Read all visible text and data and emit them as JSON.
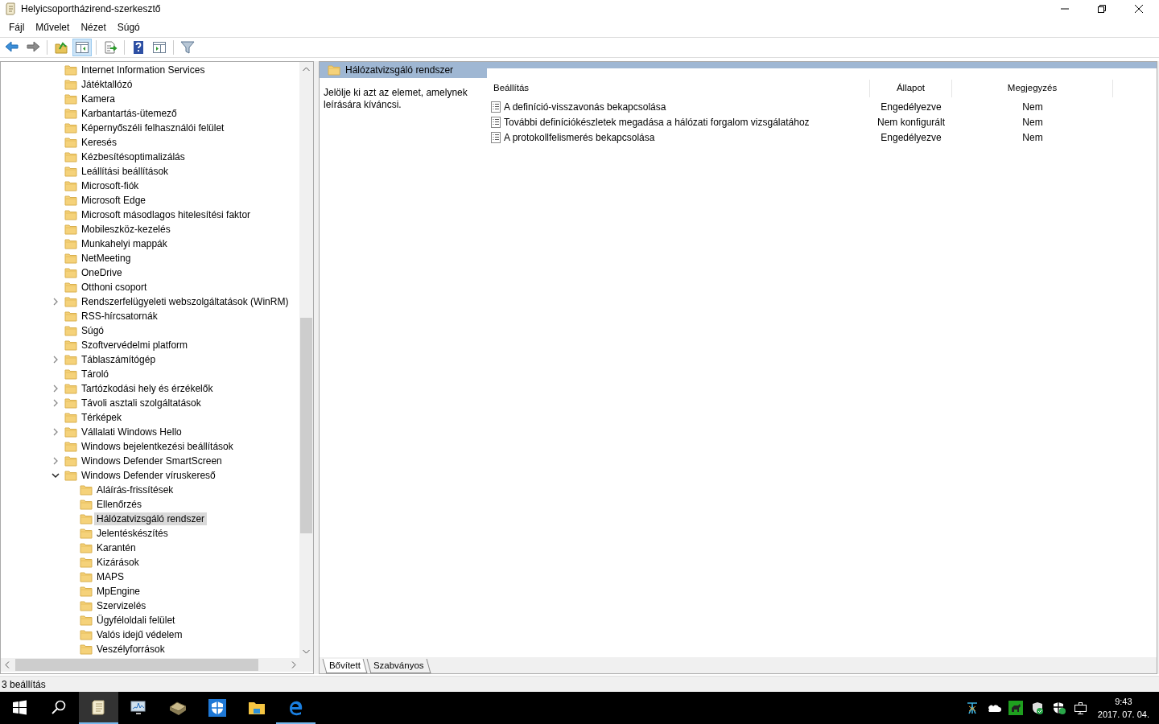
{
  "window": {
    "title": "Helyicsoportházirend-szerkesztő"
  },
  "menu": [
    "Fájl",
    "Művelet",
    "Nézet",
    "Súgó"
  ],
  "toolbar": [
    [
      {
        "kind": "back",
        "pressed": false
      },
      {
        "kind": "forward",
        "pressed": false
      }
    ],
    [
      {
        "kind": "up",
        "pressed": false
      },
      {
        "kind": "tree",
        "pressed": true
      }
    ],
    [
      {
        "kind": "export",
        "pressed": false
      }
    ],
    [
      {
        "kind": "help",
        "pressed": false
      },
      {
        "kind": "panel",
        "pressed": false
      }
    ],
    [
      {
        "kind": "filter",
        "pressed": false
      }
    ]
  ],
  "tree": [
    {
      "label": "Internet Information Services",
      "kind": "leaf",
      "selected": false
    },
    {
      "label": "Játéktallózó",
      "kind": "leaf",
      "selected": false
    },
    {
      "label": "Kamera",
      "kind": "leaf",
      "selected": false
    },
    {
      "label": "Karbantartás-ütemező",
      "kind": "leaf",
      "selected": false
    },
    {
      "label": "Képernyőszéli felhasználói felület",
      "kind": "leaf",
      "selected": false
    },
    {
      "label": "Keresés",
      "kind": "leaf",
      "selected": false
    },
    {
      "label": "Kézbesítésoptimalizálás",
      "kind": "leaf",
      "selected": false
    },
    {
      "label": "Leállítási beállítások",
      "kind": "leaf",
      "selected": false
    },
    {
      "label": "Microsoft-fiók",
      "kind": "leaf",
      "selected": false
    },
    {
      "label": "Microsoft Edge",
      "kind": "leaf",
      "selected": false
    },
    {
      "label": "Microsoft másodlagos hitelesítési faktor",
      "kind": "leaf",
      "selected": false
    },
    {
      "label": "Mobileszköz-kezelés",
      "kind": "leaf",
      "selected": false
    },
    {
      "label": "Munkahelyi mappák",
      "kind": "leaf",
      "selected": false
    },
    {
      "label": "NetMeeting",
      "kind": "leaf",
      "selected": false
    },
    {
      "label": "OneDrive",
      "kind": "leaf",
      "selected": false
    },
    {
      "label": "Otthoni csoport",
      "kind": "leaf",
      "selected": false
    },
    {
      "label": "Rendszerfelügyeleti webszolgáltatások (WinRM)",
      "kind": "group",
      "expanded": false,
      "selected": false
    },
    {
      "label": "RSS-hírcsatornák",
      "kind": "leaf",
      "selected": false
    },
    {
      "label": "Súgó",
      "kind": "leaf",
      "selected": false
    },
    {
      "label": "Szoftvervédelmi platform",
      "kind": "leaf",
      "selected": false
    },
    {
      "label": "Táblaszámítógép",
      "kind": "group",
      "expanded": false,
      "selected": false
    },
    {
      "label": "Tároló",
      "kind": "leaf",
      "selected": false
    },
    {
      "label": "Tartózkodási hely és érzékelők",
      "kind": "group",
      "expanded": false,
      "selected": false
    },
    {
      "label": "Távoli asztali szolgáltatások",
      "kind": "group",
      "expanded": false,
      "selected": false
    },
    {
      "label": "Térképek",
      "kind": "leaf",
      "selected": false
    },
    {
      "label": "Vállalati Windows Hello",
      "kind": "group",
      "expanded": false,
      "selected": false
    },
    {
      "label": "Windows bejelentkezési beállítások",
      "kind": "leaf",
      "selected": false
    },
    {
      "label": "Windows Defender SmartScreen",
      "kind": "group",
      "expanded": false,
      "selected": false
    },
    {
      "label": "Windows Defender víruskereső",
      "kind": "group",
      "expanded": true,
      "selected": false,
      "children": [
        {
          "label": "Aláírás-frissítések",
          "kind": "leaf",
          "selected": false
        },
        {
          "label": "Ellenőrzés",
          "kind": "leaf",
          "selected": false
        },
        {
          "label": "Hálózatvizsgáló rendszer",
          "kind": "leaf",
          "selected": true
        },
        {
          "label": "Jelentéskészítés",
          "kind": "leaf",
          "selected": false
        },
        {
          "label": "Karantén",
          "kind": "leaf",
          "selected": false
        },
        {
          "label": "Kizárások",
          "kind": "leaf",
          "selected": false
        },
        {
          "label": "MAPS",
          "kind": "leaf",
          "selected": false
        },
        {
          "label": "MpEngine",
          "kind": "leaf",
          "selected": false
        },
        {
          "label": "Szervizelés",
          "kind": "leaf",
          "selected": false
        },
        {
          "label": "Ügyféloldali felület",
          "kind": "leaf",
          "selected": false
        },
        {
          "label": "Valós idejű védelem",
          "kind": "leaf",
          "selected": false
        },
        {
          "label": "Veszélyforrások",
          "kind": "leaf",
          "selected": false
        }
      ]
    }
  ],
  "details": {
    "header": "Hálózatvizsgáló rendszer",
    "description": "Jelölje ki azt az elemet, amelynek leírására kíváncsi.",
    "columns": [
      "Beállítás",
      "Állapot",
      "Megjegyzés"
    ],
    "rows": [
      {
        "setting": "A definíció-visszavonás bekapcsolása",
        "state": "Engedélyezve",
        "comment": "Nem"
      },
      {
        "setting": "További definíciókészletek megadása a hálózati forgalom vizsgálatához",
        "state": "Nem konfigurált",
        "comment": "Nem"
      },
      {
        "setting": "A protokollfelismerés bekapcsolása",
        "state": "Engedélyezve",
        "comment": "Nem"
      }
    ],
    "tabs": [
      {
        "label": "Bővített",
        "selected": true
      },
      {
        "label": "Szabványos",
        "selected": false
      }
    ]
  },
  "status_bar": "3 beállítás",
  "taskbar": {
    "apps": [
      {
        "kind": "start",
        "active": false,
        "running": false
      },
      {
        "kind": "search",
        "active": false,
        "running": false
      },
      {
        "kind": "policy",
        "active": true,
        "running": true
      },
      {
        "kind": "monitor",
        "active": false,
        "running": false
      },
      {
        "kind": "drive",
        "active": false,
        "running": false
      },
      {
        "kind": "defender",
        "active": false,
        "running": false
      },
      {
        "kind": "explorer",
        "active": false,
        "running": false
      },
      {
        "kind": "edge",
        "active": false,
        "running": true
      }
    ],
    "time": "9:43",
    "date": "2017. 07. 04."
  }
}
